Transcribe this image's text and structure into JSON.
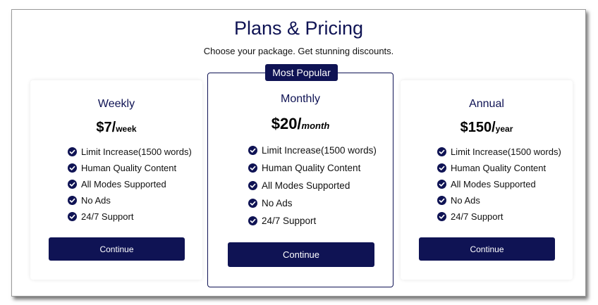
{
  "header": {
    "title": "Plans & Pricing",
    "subtitle": "Choose your package. Get stunning discounts."
  },
  "badge": "Most Popular",
  "plans": [
    {
      "name": "Weekly",
      "price": "$7/",
      "period": "week",
      "features": [
        "Limit Increase(1500 words)",
        "Human Quality Content",
        "All Modes Supported",
        "No Ads",
        "24/7 Support"
      ],
      "button": "Continue"
    },
    {
      "name": "Monthly",
      "price": "$20/",
      "period": "month",
      "features": [
        "Limit Increase(1500 words)",
        "Human Quality Content",
        "All Modes Supported",
        "No Ads",
        "24/7 Support"
      ],
      "button": "Continue"
    },
    {
      "name": "Annual",
      "price": "$150/",
      "period": "year",
      "features": [
        "Limit Increase(1500 words)",
        "Human Quality Content",
        "All Modes Supported",
        "No Ads",
        "24/7 Support"
      ],
      "button": "Continue"
    }
  ],
  "colors": {
    "accent": "#0f1354",
    "text": "#111111",
    "background": "#ffffff"
  },
  "icons": {
    "feature": "check-circle-icon"
  }
}
